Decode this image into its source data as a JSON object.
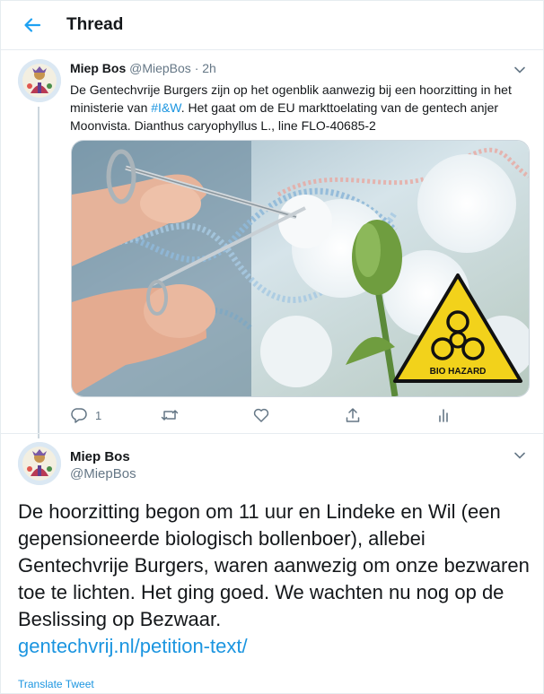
{
  "header": {
    "title": "Thread"
  },
  "tweet1": {
    "name": "Miep Bos",
    "handle": "@MiepBos",
    "time": "· 2h",
    "text_before": "De Gentechvrije Burgers zijn op het ogenblik aanwezig bij een hoorzitting in het ministerie van ",
    "hashtag": "#I&W",
    "text_after": ". Het gaat om de EU markttoelating van de gentech anjer Moonvista. Dianthus caryophyllus L., line FLO-40685-2",
    "image_sign_text": "BIO HAZARD",
    "reply_count": "1"
  },
  "tweet2": {
    "name": "Miep Bos",
    "handle": "@MiepBos",
    "text": "De hoorzitting begon om 11 uur en Lindeke en Wil (een gepensioneerde biologisch bollenboer), allebei Gentechvrije Burgers, waren aanwezig om onze bezwaren toe te lichten. Het ging goed. We wachten nu nog op de Beslissing op Bezwaar.",
    "link": "gentechvrij.nl/petition-text/",
    "translate": "Translate Tweet"
  },
  "colors": {
    "accent": "#1da1f2",
    "link": "#1b95e0",
    "secondary_text": "#657786",
    "border": "#e6ecf0"
  },
  "icons": [
    "back-arrow-icon",
    "chevron-down-icon",
    "reply-icon",
    "retweet-icon",
    "like-icon",
    "share-icon",
    "analytics-icon",
    "biohazard-icon"
  ]
}
